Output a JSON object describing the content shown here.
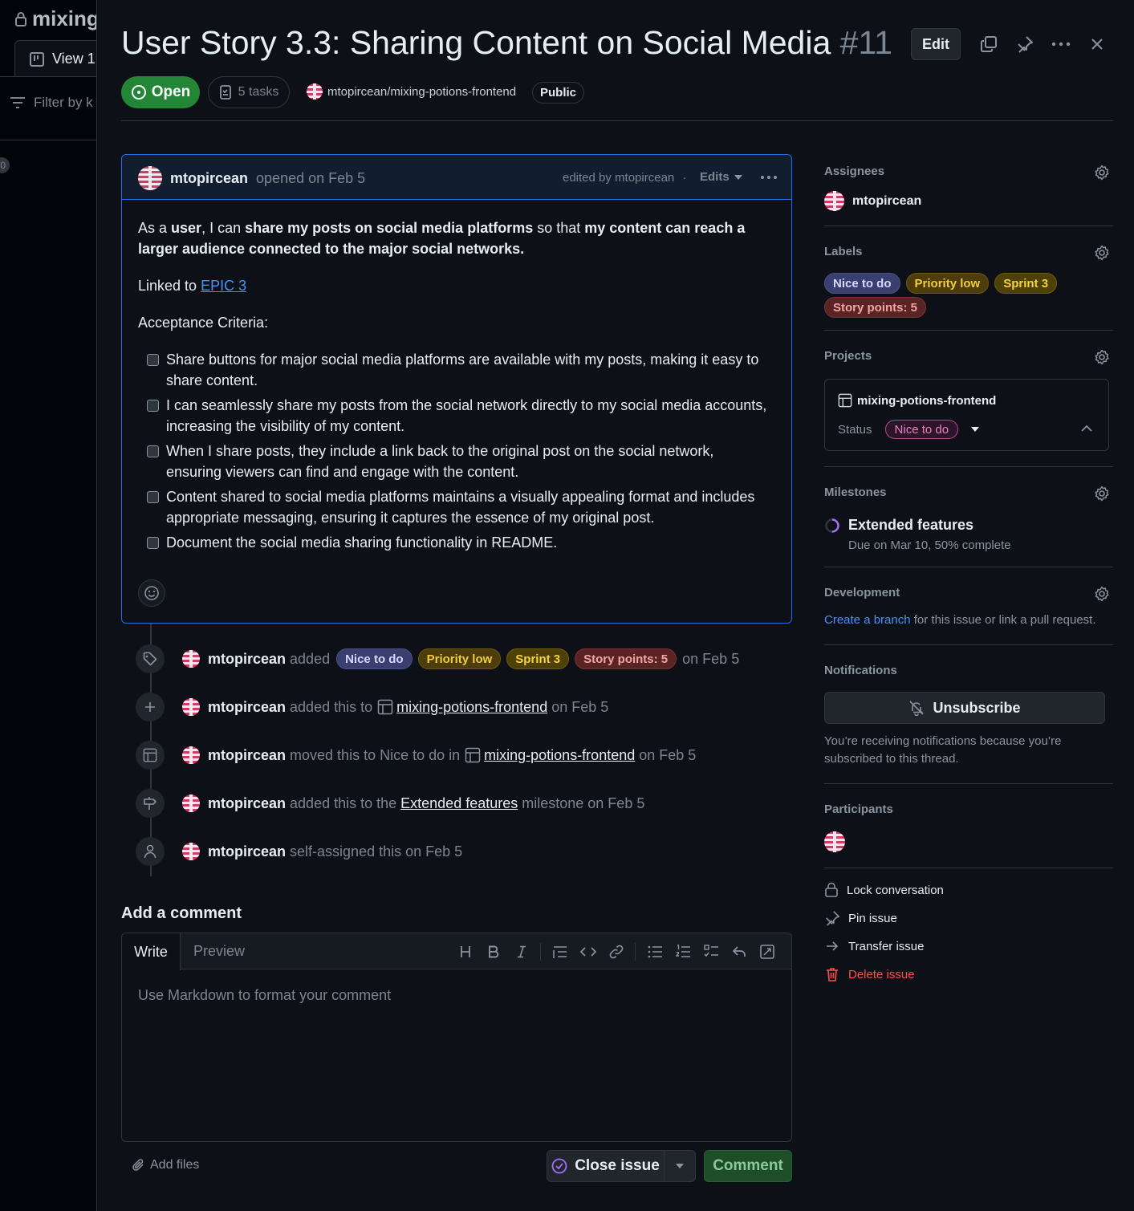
{
  "left_panel": {
    "title": "mixing",
    "view_tab": "View 1",
    "filter_placeholder": "Filter by k",
    "count": "0"
  },
  "issue": {
    "title": "User Story 3.3: Sharing Content on Social Media",
    "number": "#11",
    "edit_label": "Edit",
    "state": "Open",
    "tasks": "5 tasks",
    "repo": "mtopircean/mixing-potions-frontend",
    "visibility": "Public"
  },
  "body": {
    "author": "mtopircean",
    "opened": "opened on Feb 5",
    "edited_by": "edited by mtopircean",
    "edits_label": "Edits",
    "intro": {
      "p1": "As a ",
      "p1_b1": "user",
      "p2": ", I can ",
      "p2_b2": "share my posts on social media platforms",
      "p3": " so that ",
      "p3_b3": "my content can reach a larger audience connected to the major social networks."
    },
    "linked_prefix": "Linked to ",
    "linked_link": "EPIC 3",
    "criteria_heading": "Acceptance Criteria:",
    "criteria": [
      "Share buttons for major social media platforms are available with my posts, making it easy to share content.",
      "I can seamlessly share my posts from the social network directly to my social media accounts, increasing the visibility of my content.",
      "When I share posts, they include a link back to the original post on the social network, ensuring viewers can find and engage with the content.",
      "Content shared to social media platforms maintains a visually appealing format and includes appropriate messaging, ensuring it captures the essence of my original post.",
      "Document the social media sharing functionality in README."
    ]
  },
  "timeline": {
    "user": "mtopircean",
    "e1": {
      "verb": "added",
      "labels": [
        "Nice to do",
        "Priority low",
        "Sprint 3",
        "Story points: 5"
      ],
      "when": "on Feb 5"
    },
    "e2": {
      "verb": "added this to",
      "target": "mixing-potions-frontend",
      "when": "on Feb 5"
    },
    "e3": {
      "verb": "moved this to Nice to do in",
      "target": "mixing-potions-frontend",
      "when": "on Feb 5"
    },
    "e4": {
      "verb": "added this to the",
      "target": "Extended features",
      "suffix": "milestone on Feb 5"
    },
    "e5": {
      "verb": "self-assigned this on Feb 5"
    }
  },
  "composer": {
    "heading": "Add a comment",
    "tab_write": "Write",
    "tab_preview": "Preview",
    "placeholder": "Use Markdown to format your comment",
    "add_files": "Add files",
    "close_issue": "Close issue",
    "comment": "Comment",
    "tools": [
      "heading-icon",
      "bold-icon",
      "italic-icon",
      "quote-icon",
      "code-icon",
      "link-icon",
      "bullet-list-icon",
      "numbered-list-icon",
      "task-list-icon",
      "reply-icon",
      "fullscreen-icon"
    ]
  },
  "sidebar": {
    "assignees_h": "Assignees",
    "assignee": "mtopircean",
    "labels_h": "Labels",
    "labels": [
      "Nice to do",
      "Priority low",
      "Sprint 3",
      "Story points: 5"
    ],
    "projects_h": "Projects",
    "project_name": "mixing-potions-frontend",
    "status_label": "Status",
    "status_value": "Nice to do",
    "milestones_h": "Milestones",
    "milestone_name": "Extended features",
    "milestone_due": "Due on Mar 10, 50% complete",
    "milestone_progress": 0.5,
    "development_h": "Development",
    "dev_link": "Create a branch",
    "dev_text": " for this issue or link a pull request.",
    "notifications_h": "Notifications",
    "unsubscribe": "Unsubscribe",
    "notif_text": "You’re receiving notifications because you’re subscribed to this thread.",
    "participants_h": "Participants",
    "actions": {
      "lock": "Lock conversation",
      "pin": "Pin issue",
      "transfer": "Transfer issue",
      "delete": "Delete issue"
    }
  },
  "colors": {
    "background": "#0d1117",
    "open_green": "#238636",
    "link_blue": "#4493f8",
    "delete_red": "#f85149",
    "milestone_purple": "#a371f7"
  }
}
